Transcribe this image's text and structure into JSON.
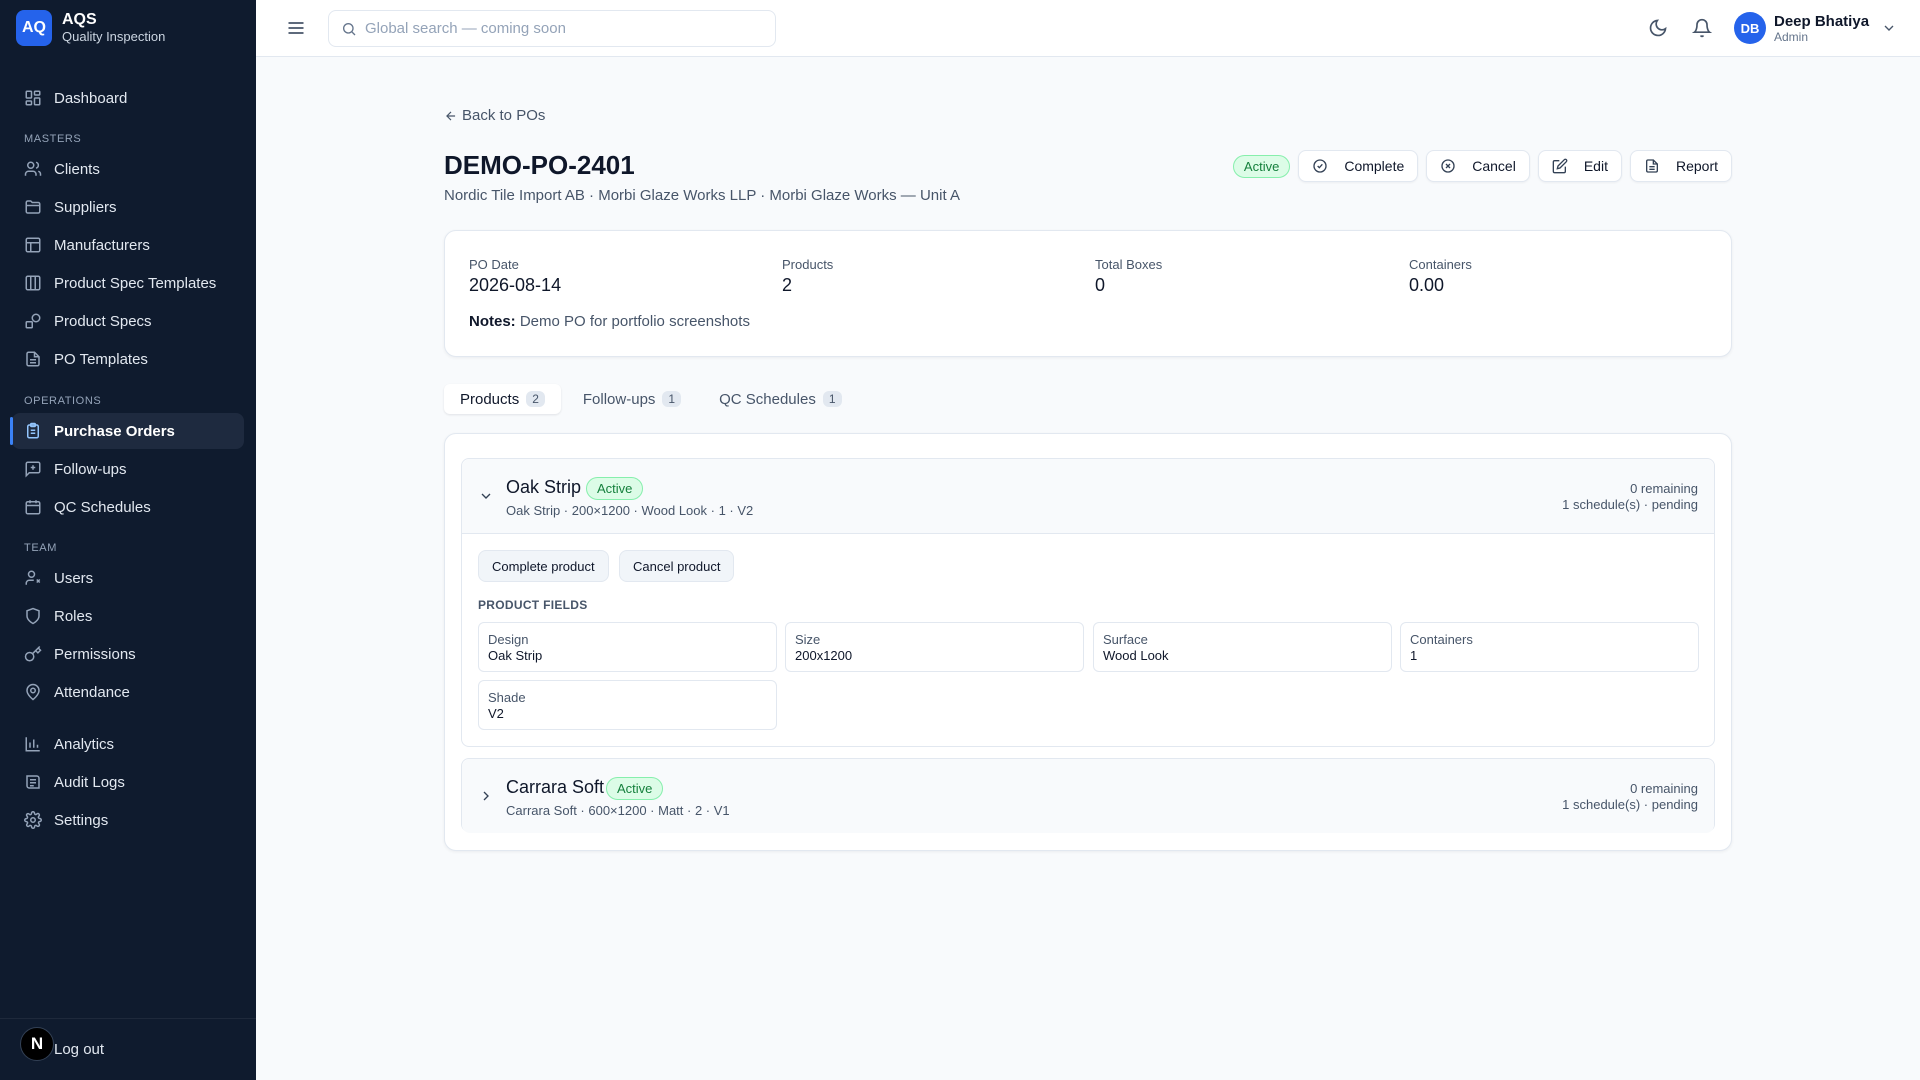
{
  "brand": {
    "logo": "AQ",
    "name": "AQS",
    "subtitle": "Quality Inspection"
  },
  "sidebar": {
    "dashboard": {
      "label": "Dashboard",
      "icon": "dashboard-icon"
    },
    "masters_heading": "MASTERS",
    "masters": [
      {
        "label": "Clients",
        "icon": "users-icon"
      },
      {
        "label": "Suppliers",
        "icon": "folder-icon"
      },
      {
        "label": "Manufacturers",
        "icon": "factory-icon"
      },
      {
        "label": "Product Spec Templates",
        "icon": "columns-icon"
      },
      {
        "label": "Product Specs",
        "icon": "shapes-icon"
      },
      {
        "label": "PO Templates",
        "icon": "document-icon"
      }
    ],
    "operations_heading": "OPERATIONS",
    "operations": [
      {
        "label": "Purchase Orders",
        "icon": "clipboard-icon",
        "active": true
      },
      {
        "label": "Follow-ups",
        "icon": "message-icon"
      },
      {
        "label": "QC Schedules",
        "icon": "calendar-icon"
      }
    ],
    "team_heading": "TEAM",
    "team": [
      {
        "label": "Users",
        "icon": "user-icon"
      },
      {
        "label": "Roles",
        "icon": "shield-icon"
      },
      {
        "label": "Permissions",
        "icon": "key-icon"
      },
      {
        "label": "Attendance",
        "icon": "location-icon"
      }
    ],
    "other": [
      {
        "label": "Analytics",
        "icon": "bar-chart-icon"
      },
      {
        "label": "Audit Logs",
        "icon": "audit-icon"
      },
      {
        "label": "Settings",
        "icon": "gear-icon"
      }
    ],
    "footer_badge": "N",
    "logout": "Log out"
  },
  "topbar": {
    "search_placeholder": "Global search — coming soon",
    "user": {
      "initials": "DB",
      "name": "Deep Bhatiya",
      "role": "Admin"
    }
  },
  "po": {
    "back_label": "Back to POs",
    "title": "DEMO-PO-2401",
    "subtitle": "Nordic Tile Import AB · Morbi Glaze Works LLP · Morbi Glaze Works — Unit A",
    "status": "Active",
    "actions": {
      "complete": "Complete",
      "cancel": "Cancel",
      "edit": "Edit",
      "report": "Report"
    },
    "stats": [
      {
        "label": "PO Date",
        "value": "2026-08-14"
      },
      {
        "label": "Products",
        "value": "2"
      },
      {
        "label": "Total Boxes",
        "value": "0"
      },
      {
        "label": "Containers",
        "value": "0.00"
      }
    ],
    "notes_label": "Notes:",
    "notes": "Demo PO for portfolio screenshots"
  },
  "tabs": [
    {
      "label": "Products",
      "count": "2",
      "active": true
    },
    {
      "label": "Follow-ups",
      "count": "1"
    },
    {
      "label": "QC Schedules",
      "count": "1"
    }
  ],
  "products": [
    {
      "name": "Oak Strip",
      "status": "Active",
      "meta": "Oak Strip · 200×1200 · Wood Look · 1 · V2",
      "remaining": "0 remaining",
      "schedules": "1 schedule(s) · pending",
      "expanded": true,
      "complete_label": "Complete product",
      "cancel_label": "Cancel product",
      "fields_heading": "PRODUCT FIELDS",
      "fields": [
        {
          "label": "Design",
          "value": "Oak Strip"
        },
        {
          "label": "Size",
          "value": "200x1200"
        },
        {
          "label": "Surface",
          "value": "Wood Look"
        },
        {
          "label": "Containers",
          "value": "1"
        },
        {
          "label": "Shade",
          "value": "V2"
        }
      ]
    },
    {
      "name": "Carrara Soft",
      "status": "Active",
      "meta": "Carrara Soft · 600×1200 · Matt · 2 · V1",
      "remaining": "0 remaining",
      "schedules": "1 schedule(s) · pending",
      "expanded": false
    }
  ],
  "colors": {
    "sidebar_bg": "#0f1b2e",
    "accent": "#2563eb",
    "active_badge_bg": "#dcfce7",
    "active_badge_text": "#15803d"
  }
}
